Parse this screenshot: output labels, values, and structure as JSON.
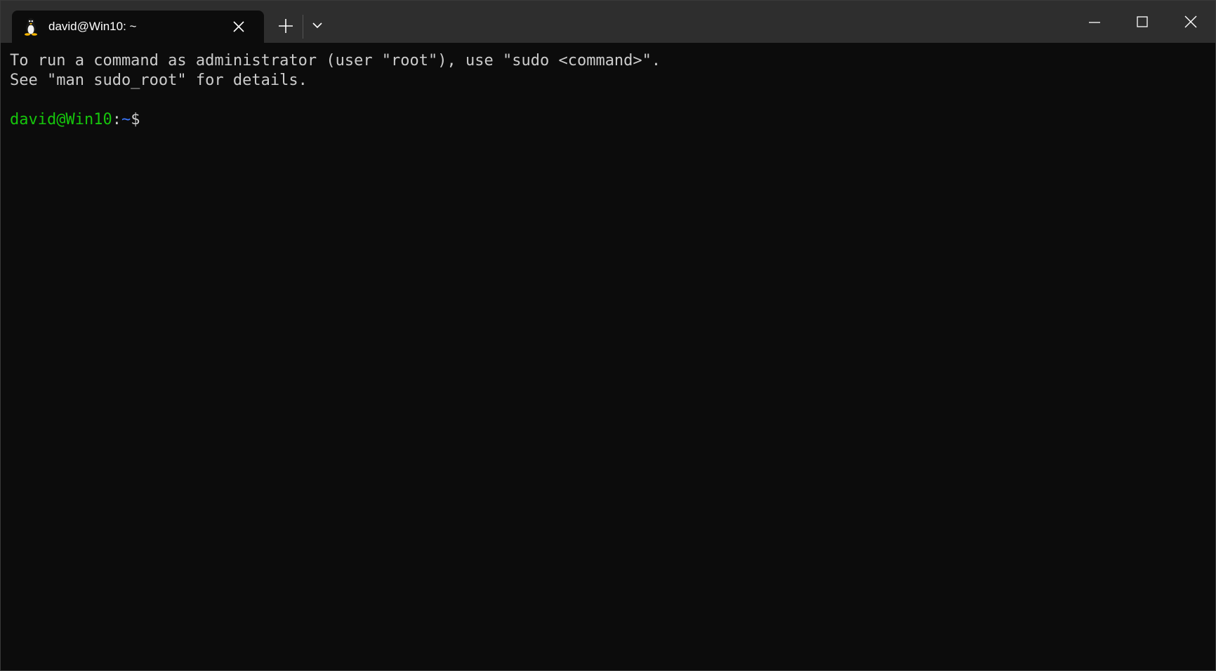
{
  "tab": {
    "title": "david@Win10: ~",
    "icon": "linux-penguin-icon"
  },
  "titlebar": {
    "new_tab_icon": "plus-icon",
    "dropdown_icon": "chevron-down-icon",
    "minimize_icon": "minimize-icon",
    "maximize_icon": "maximize-icon",
    "close_icon": "close-icon"
  },
  "terminal": {
    "lines": [
      "To run a command as administrator (user \"root\"), use \"sudo <command>\".",
      "See \"man sudo_root\" for details.",
      ""
    ],
    "prompt": {
      "user_host": "david@Win10",
      "separator": ":",
      "path": "~",
      "sign": "$"
    }
  },
  "colors": {
    "background": "#0c0c0c",
    "titlebar": "#2e2e2e",
    "text": "#cccccc",
    "prompt_user": "#16c60c",
    "prompt_path": "#3b78ff"
  }
}
